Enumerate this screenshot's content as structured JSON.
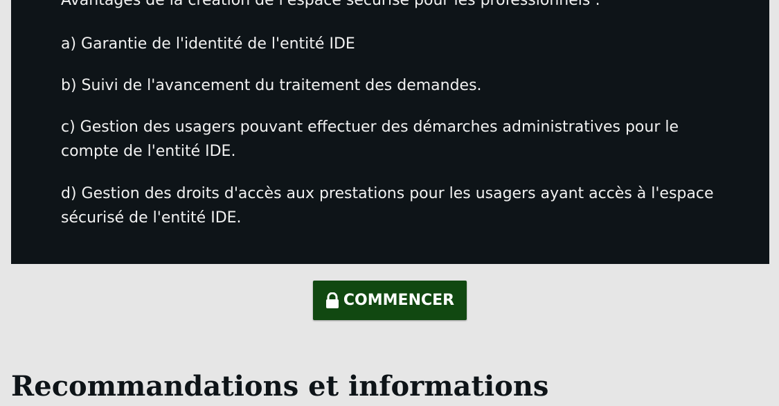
{
  "panel": {
    "intro": "Avantages de la création de l'espace sécurisé pour les professionnels :",
    "items": [
      "a) Garantie de l'identité de l'entité IDE",
      "b) Suivi de l'avancement du traitement des demandes.",
      "c) Gestion des usagers pouvant effectuer des démarches administratives pour le compte de l'entité IDE.",
      "d) Gestion des droits d'accès aux prestations pour les usagers ayant accès à l'espace sécurisé de l'entité IDE."
    ]
  },
  "start_button": {
    "label": "COMMENCER",
    "icon": "lock-icon"
  },
  "section": {
    "heading": "Recommandations et informations"
  },
  "colors": {
    "panel_bg": "#0e1418",
    "page_bg": "#e6e6e6",
    "button_bg": "#114811"
  }
}
